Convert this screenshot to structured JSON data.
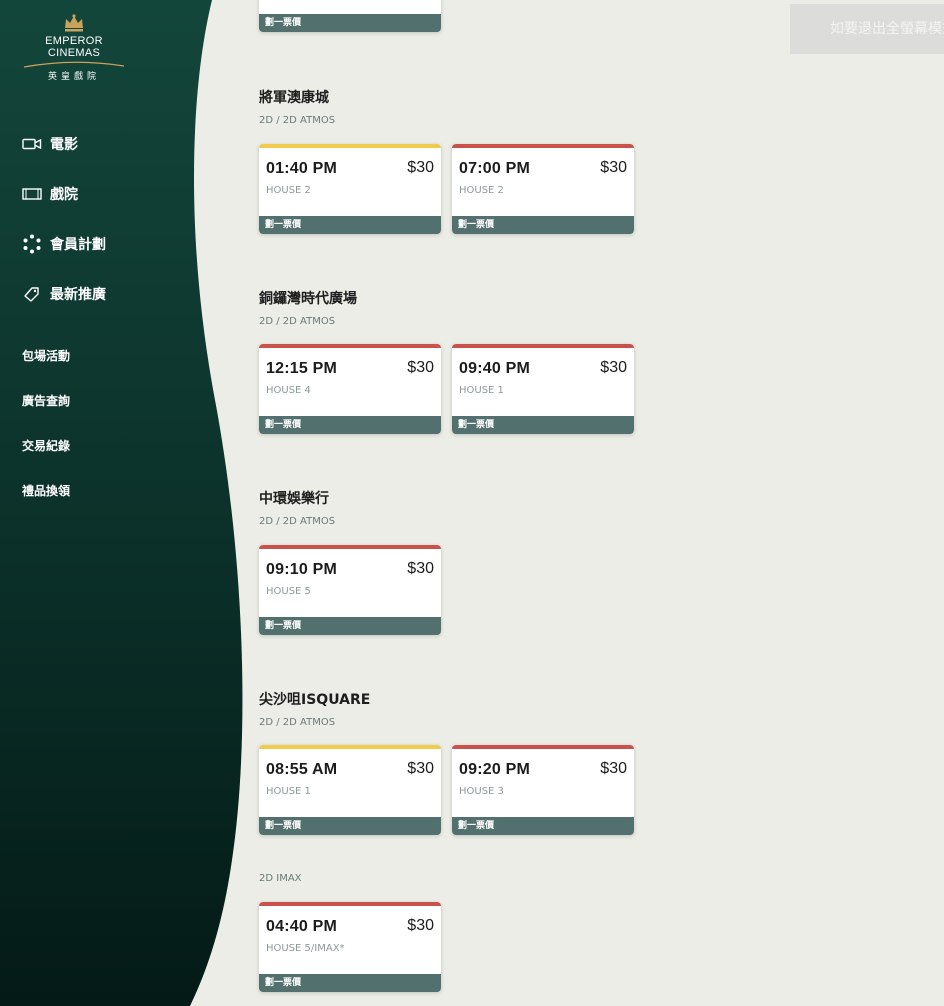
{
  "brand": {
    "line1": "EMPEROR",
    "line2": "CINEMAS",
    "line3": "英皇戲院",
    "colors": {
      "sidebar_top": "#13463b",
      "sidebar_bottom": "#041a16",
      "gold": "#c9a35d"
    }
  },
  "nav": {
    "main": [
      {
        "label": "電影",
        "icon": "video-camera-icon"
      },
      {
        "label": "戲院",
        "icon": "film-frame-icon"
      },
      {
        "label": "會員計劃",
        "icon": "dots-circle-icon"
      },
      {
        "label": "最新推廣",
        "icon": "tag-icon"
      }
    ],
    "secondary": [
      {
        "label": "包場活動"
      },
      {
        "label": "廣告查詢"
      },
      {
        "label": "交易紀錄"
      },
      {
        "label": "禮品換領"
      }
    ]
  },
  "fullscreen_notice": "如要退出全螢幕模式",
  "stripe_colors": {
    "yellow": "#f0cb4e",
    "red": "#c9524c"
  },
  "top_card": {
    "footer": "劃一票價"
  },
  "cinemas": [
    {
      "name": "將軍澳康城",
      "format": "2D / 2D ATMOS",
      "sessions": [
        {
          "time": "01:40 PM",
          "price": "$30",
          "house": "HOUSE 2",
          "footer": "劃一票價",
          "stripe": "yellow"
        },
        {
          "time": "07:00 PM",
          "price": "$30",
          "house": "HOUSE 2",
          "footer": "劃一票價",
          "stripe": "red"
        }
      ]
    },
    {
      "name": "銅鑼灣時代廣場",
      "format": "2D / 2D ATMOS",
      "sessions": [
        {
          "time": "12:15 PM",
          "price": "$30",
          "house": "HOUSE 4",
          "footer": "劃一票價",
          "stripe": "red"
        },
        {
          "time": "09:40 PM",
          "price": "$30",
          "house": "HOUSE 1",
          "footer": "劃一票價",
          "stripe": "red"
        }
      ]
    },
    {
      "name": "中環娛樂行",
      "format": "2D / 2D ATMOS",
      "sessions": [
        {
          "time": "09:10 PM",
          "price": "$30",
          "house": "HOUSE 5",
          "footer": "劃一票價",
          "stripe": "red"
        }
      ]
    },
    {
      "name": "尖沙咀ISQUARE",
      "format": "2D / 2D ATMOS",
      "sessions": [
        {
          "time": "08:55 AM",
          "price": "$30",
          "house": "HOUSE 1",
          "footer": "劃一票價",
          "stripe": "yellow"
        },
        {
          "time": "09:20 PM",
          "price": "$30",
          "house": "HOUSE 3",
          "footer": "劃一票價",
          "stripe": "red"
        }
      ],
      "extra_format": "2D IMAX",
      "extra_sessions": [
        {
          "time": "04:40 PM",
          "price": "$30",
          "house": "HOUSE 5/IMAX*",
          "footer": "劃一票價",
          "stripe": "red"
        }
      ]
    }
  ]
}
